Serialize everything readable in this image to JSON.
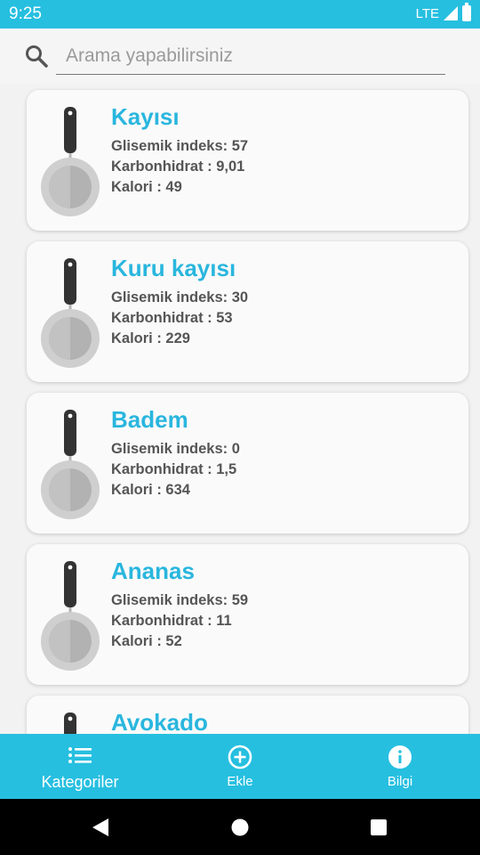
{
  "status_bar": {
    "time": "9:25",
    "network": "LTE"
  },
  "search": {
    "placeholder": "Arama yapabilirsiniz",
    "value": ""
  },
  "foods": [
    {
      "name": "Kayısı",
      "gi_label": "Glisemik indeks: 57",
      "carb_label": "Karbonhidrat : 9,01",
      "cal_label": "Kalori : 49"
    },
    {
      "name": "Kuru kayısı",
      "gi_label": "Glisemik indeks: 30",
      "carb_label": "Karbonhidrat : 53",
      "cal_label": "Kalori : 229"
    },
    {
      "name": "Badem",
      "gi_label": "Glisemik indeks: 0",
      "carb_label": "Karbonhidrat : 1,5",
      "cal_label": "Kalori : 634"
    },
    {
      "name": "Ananas",
      "gi_label": "Glisemik indeks: 59",
      "carb_label": "Karbonhidrat : 11",
      "cal_label": "Kalori : 52"
    },
    {
      "name": "Avokado",
      "gi_label": "",
      "carb_label": "",
      "cal_label": ""
    }
  ],
  "bottom_nav": {
    "items": [
      {
        "label": "Kategoriler",
        "icon": "list-icon",
        "active": true
      },
      {
        "label": "Ekle",
        "icon": "add-circle-icon",
        "active": false
      },
      {
        "label": "Bilgi",
        "icon": "info-icon",
        "active": false
      }
    ]
  },
  "colors": {
    "accent": "#26bfe0",
    "title": "#29b6de",
    "text": "#555555"
  }
}
